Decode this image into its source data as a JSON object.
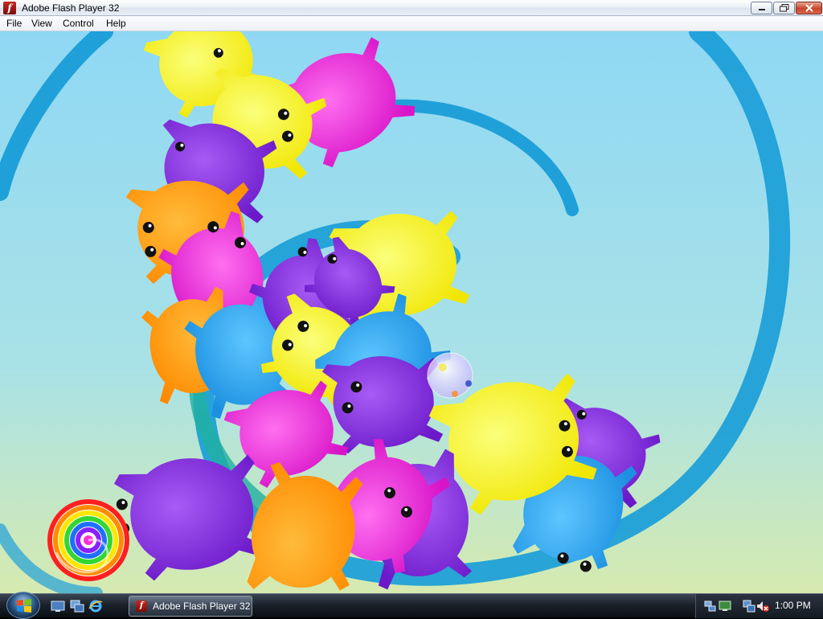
{
  "window": {
    "title": "Adobe Flash Player 32",
    "icon": "flash-icon",
    "buttons": [
      "minimize-icon",
      "maximize-icon",
      "close-icon"
    ]
  },
  "menu": {
    "items": [
      {
        "label": "File"
      },
      {
        "label": "View"
      },
      {
        "label": "Control"
      },
      {
        "label": "Help"
      }
    ]
  },
  "taskbar": {
    "start": "windows-start-orb",
    "quick_launch": [
      "show-desktop-icon",
      "switch-windows-icon",
      "internet-explorer-icon"
    ],
    "task_label": "Adobe Flash Player 32",
    "tray_icons": [
      "network-icon",
      "display-icon",
      "volume-muted-icon"
    ],
    "clock": "1:00 PM"
  },
  "scene": {
    "colors": {
      "sky_top": "#8fd8f4",
      "sky_bottom": "#cfe8b8",
      "spiral": "#1fa0d8",
      "yellow": "#f7f22a",
      "magenta": "#e832d6",
      "purple": "#8a2fe0",
      "orange": "#ff9a12",
      "blue": "#2aa6ef"
    }
  }
}
